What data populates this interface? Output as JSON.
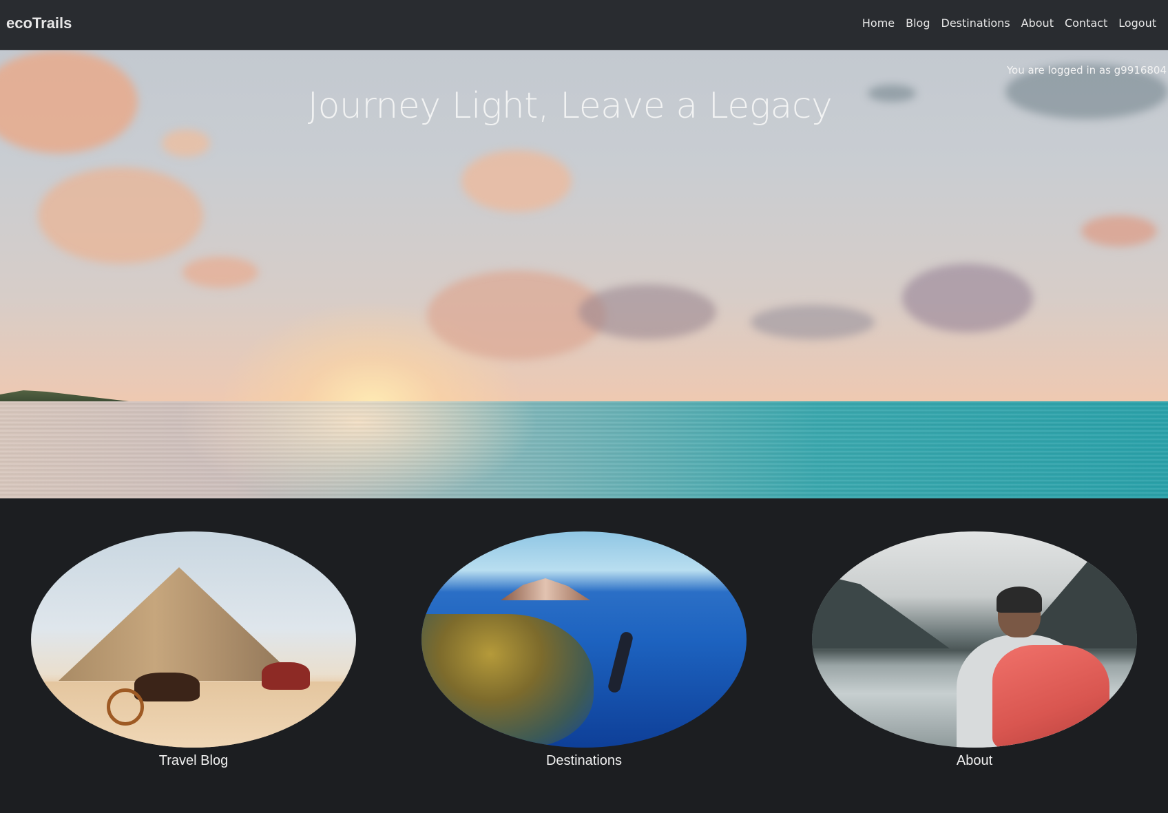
{
  "navbar": {
    "brand": "ecoTrails",
    "links": [
      "Home",
      "Blog",
      "Destinations",
      "About",
      "Contact",
      "Logout"
    ]
  },
  "hero": {
    "login_status": "You are logged in as g9916804",
    "title": "Journey Light, Leave a Legacy"
  },
  "cards": [
    {
      "label": "Travel Blog"
    },
    {
      "label": "Destinations"
    },
    {
      "label": "About"
    }
  ],
  "colors": {
    "navbar_bg": "#292c30",
    "page_bg": "#1c1e21",
    "text_light": "#e8e8e8"
  }
}
